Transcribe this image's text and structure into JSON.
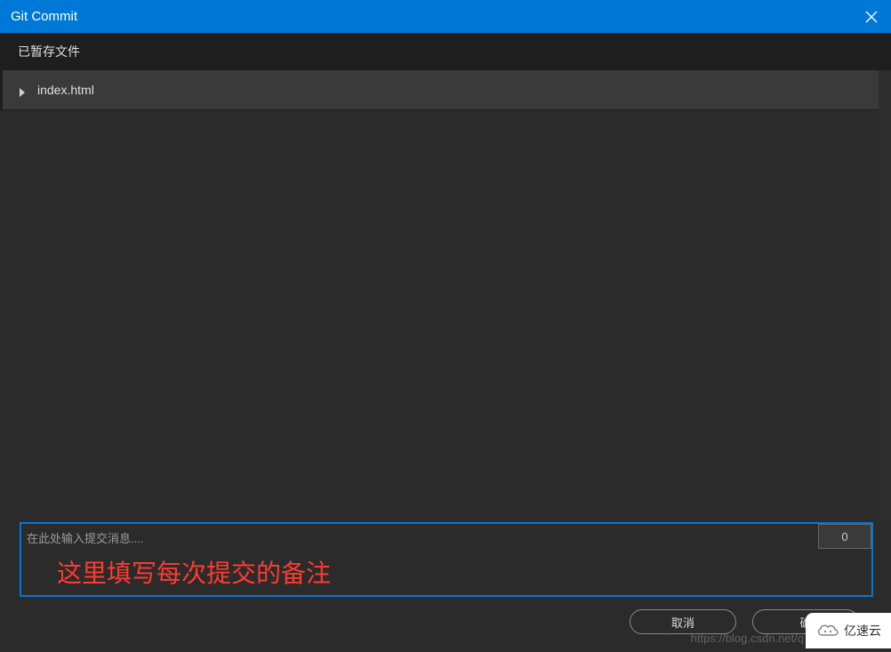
{
  "window": {
    "title": "Git Commit"
  },
  "panel": {
    "staged_header": "已暂存文件"
  },
  "files": [
    {
      "name": "index.html"
    }
  ],
  "commit": {
    "placeholder": "在此处输入提交消息....",
    "char_count": "0",
    "annotation": "这里填写每次提交的备注"
  },
  "buttons": {
    "cancel": "取消",
    "confirm": "确"
  },
  "watermark": {
    "url": "https://blog.csdn.net/q",
    "brand": "亿速云"
  }
}
